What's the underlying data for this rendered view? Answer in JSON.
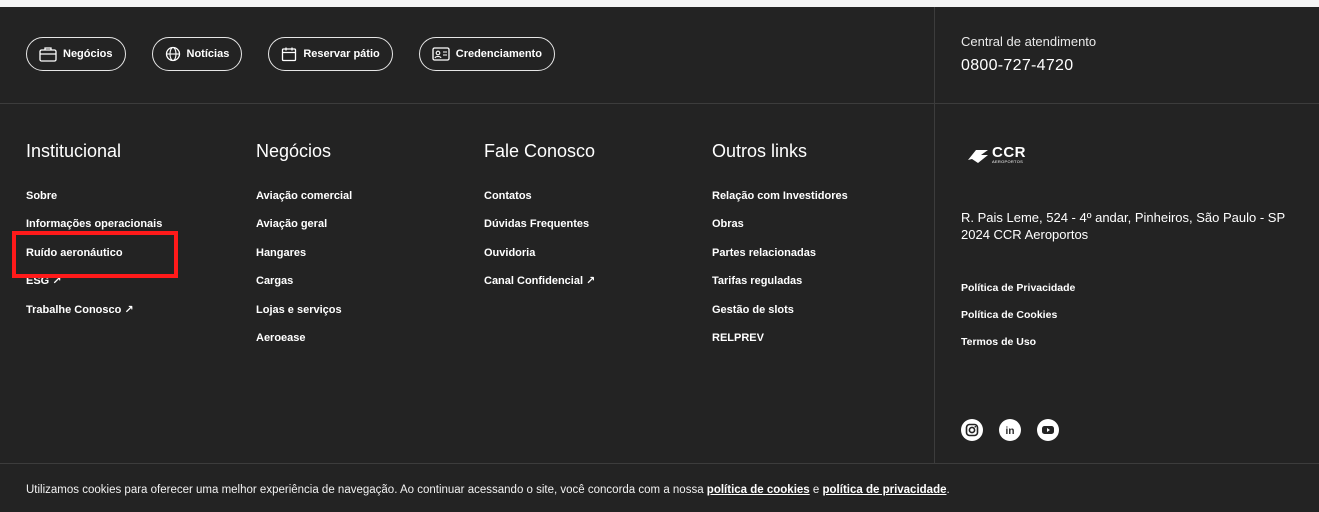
{
  "quick_links": [
    {
      "label": "Negócios",
      "icon": "briefcase-icon"
    },
    {
      "label": "Notícias",
      "icon": "globe-icon"
    },
    {
      "label": "Reservar pátio",
      "icon": "calendar-icon"
    },
    {
      "label": "Credenciamento",
      "icon": "id-card-icon"
    }
  ],
  "contact": {
    "label": "Central de atendimento",
    "phone": "0800-727-4720"
  },
  "columns": {
    "institucional": {
      "title": "Institucional",
      "links": [
        "Sobre",
        "Informações operacionais",
        "Ruído aeronáutico",
        "ESG",
        "Trabalhe Conosco"
      ]
    },
    "negocios": {
      "title": "Negócios",
      "links": [
        "Aviação comercial",
        "Aviação geral",
        "Hangares",
        "Cargas",
        "Lojas e serviços",
        "Aeroease"
      ]
    },
    "fale": {
      "title": "Fale Conosco",
      "links": [
        "Contatos",
        "Dúvidas Frequentes",
        "Ouvidoria",
        "Canal Confidencial"
      ]
    },
    "outros": {
      "title": "Outros links",
      "links": [
        "Relação com Investidores",
        "Obras",
        "Partes relacionadas",
        "Tarifas reguladas",
        "Gestão de slots",
        "RELPREV"
      ]
    }
  },
  "external_arrow": "↗",
  "logo": {
    "brand": "CCR",
    "sub": "AEROPORTOS"
  },
  "address": {
    "line1": "R. Pais Leme, 524 - 4º andar, Pinheiros, São Paulo - SP",
    "line2": "2024  CCR Aeroportos"
  },
  "legal_links": [
    "Política de Privacidade",
    "Política de Cookies",
    "Termos de Uso"
  ],
  "social": [
    "instagram-icon",
    "linkedin-icon",
    "youtube-icon"
  ],
  "cookie_banner": {
    "text": "Utilizamos cookies para oferecer uma melhor experiência de navegação. Ao continuar acessando o site, você concorda com a nossa ",
    "link1": "política de cookies",
    "between": " e ",
    "link2": "política de privacidade",
    "end": "."
  },
  "colors": {
    "background": "#232323",
    "highlight": "#ff1a1a",
    "text": "#ffffff"
  }
}
